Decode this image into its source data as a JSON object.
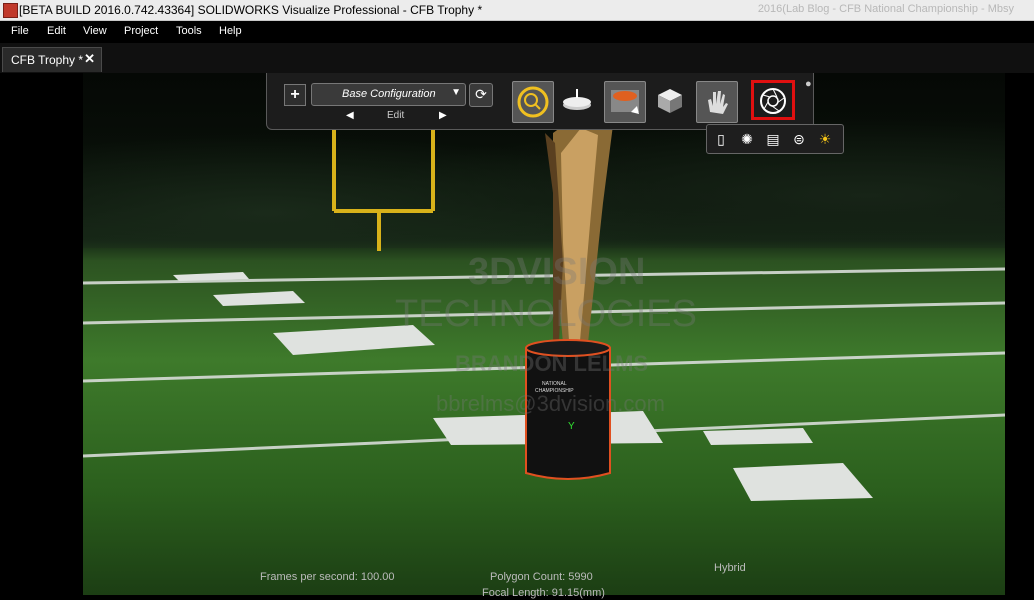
{
  "window": {
    "title": "[BETA BUILD 2016.0.742.43364] SOLIDWORKS Visualize Professional - CFB Trophy *",
    "background_title": "2016(Lab Blog - CFB National Championship - Mbsy"
  },
  "menu": [
    "File",
    "Edit",
    "View",
    "Project",
    "Tools",
    "Help"
  ],
  "tab": {
    "label": "CFB Trophy *",
    "close": "✕"
  },
  "toolbar": {
    "add_label": "+",
    "configuration": "Base Configuration",
    "edit_label": "Edit",
    "prev": "◀",
    "next": "▶",
    "refresh": "⟳",
    "tools": [
      {
        "name": "zoom-tool-icon",
        "active": true
      },
      {
        "name": "turntable-icon",
        "active": false
      },
      {
        "name": "environment-icon",
        "active": true
      },
      {
        "name": "object-icon",
        "active": false
      },
      {
        "name": "hand-icon",
        "active": true
      },
      {
        "name": "camera-aperture-icon",
        "active": false,
        "highlighted": true
      }
    ]
  },
  "sub_toolbar": [
    "panel-icon",
    "aperture-icon",
    "clapboard-icon",
    "turntable-icon",
    "sun-icon"
  ],
  "viewport": {
    "axis_y": "Y",
    "watermark_lines": [
      "3DVISION",
      "TECHNOLOGIES",
      "BRANDON LELMS",
      "bbrelms@3dvision.com"
    ],
    "trophy_text": [
      "NATIONAL",
      "CHAMPIONSHIP"
    ]
  },
  "status": {
    "fps": "Frames per second: 100.00",
    "polygons": "Polygon Count: 5990",
    "mode": "Hybrid",
    "focal": "Focal Length: 91.15(mm)"
  },
  "colors": {
    "highlight": "#e01010",
    "accent": "#f0c020"
  }
}
